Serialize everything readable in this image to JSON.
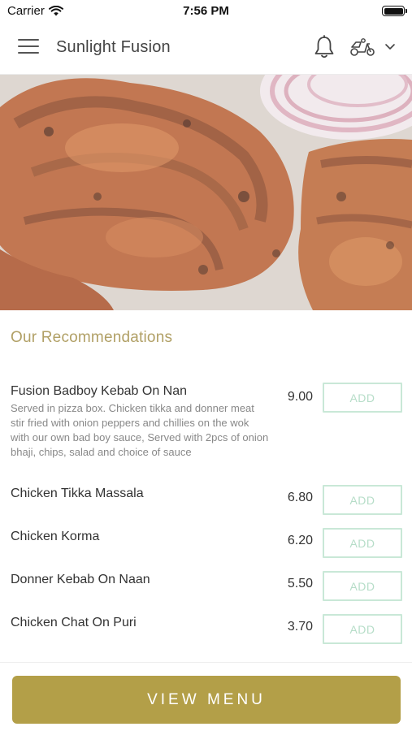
{
  "status_bar": {
    "carrier": "Carrier",
    "time": "7:56 PM"
  },
  "header": {
    "title": "Sunlight Fusion"
  },
  "section": {
    "title": "Our Recommendations"
  },
  "items": [
    {
      "name": "Fusion Badboy Kebab On Nan",
      "description": "Served in pizza box. Chicken tikka and donner meat stir fried with onion peppers and chillies on the wok with our own bad boy sauce, Served with 2pcs of onion bhaji, chips, salad and choice of sauce",
      "price": "9.00",
      "add_label": "ADD"
    },
    {
      "name": "Chicken Tikka Massala",
      "description": "",
      "price": "6.80",
      "add_label": "ADD"
    },
    {
      "name": "Chicken Korma",
      "description": "",
      "price": "6.20",
      "add_label": "ADD"
    },
    {
      "name": "Donner Kebab On Naan",
      "description": "",
      "price": "5.50",
      "add_label": "ADD"
    },
    {
      "name": "Chicken Chat On Puri",
      "description": "",
      "price": "3.70",
      "add_label": "ADD"
    }
  ],
  "bottom": {
    "view_menu_label": "VIEW MENU"
  },
  "colors": {
    "accent": "#b39f48",
    "section_title": "#b1a066",
    "add_border": "#c9e8d7"
  },
  "icons": {
    "menu": "hamburger-menu-icon",
    "notifications": "bell-icon",
    "delivery": "scooter-icon",
    "dropdown": "chevron-down-icon"
  }
}
